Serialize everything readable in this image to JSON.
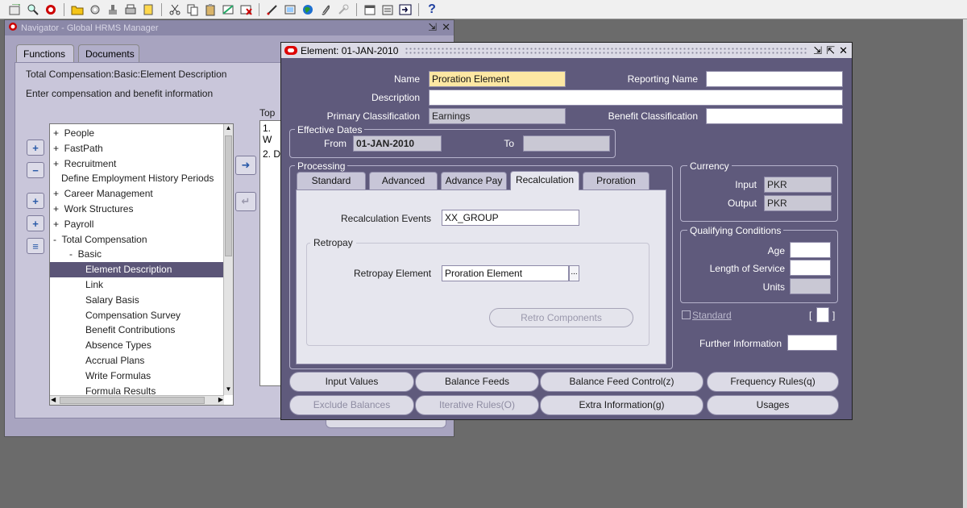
{
  "toolbar": {
    "icons": [
      "new-icon",
      "find-icon",
      "navigator-icon",
      "folder-icon",
      "gear-icon",
      "stamp-icon",
      "print-icon",
      "attachment-icon",
      "cut-icon",
      "copy-icon",
      "paste-icon",
      "clear-record-icon",
      "delete-icon",
      "edit-icon",
      "zoom-icon",
      "globe-icon",
      "paperclip-icon",
      "tools-icon",
      "calendar-icon",
      "folder-tools-icon",
      "window-icon",
      "help-icon"
    ],
    "help_label": "?"
  },
  "navigator": {
    "title": "Navigator - Global HRMS Manager",
    "controls": [
      "⇲",
      "✕"
    ],
    "tabs": [
      {
        "label": "Functions",
        "active": true
      },
      {
        "label": "Documents",
        "active": false
      }
    ],
    "path": "Total Compensation:Basic:Element Description",
    "hint": "Enter compensation and benefit information",
    "top_label": "Top",
    "top_items": [
      "1. W",
      "2. D"
    ],
    "tree": [
      {
        "label": "+  People",
        "indent": 0
      },
      {
        "label": "+  FastPath",
        "indent": 0
      },
      {
        "label": "+  Recruitment",
        "indent": 0
      },
      {
        "label": "   Define Employment History Periods",
        "indent": 0
      },
      {
        "label": "+  Career Management",
        "indent": 0
      },
      {
        "label": "+  Work Structures",
        "indent": 0
      },
      {
        "label": "+  Payroll",
        "indent": 0
      },
      {
        "label": "-  Total Compensation",
        "indent": 0
      },
      {
        "label": "-  Basic",
        "indent": 1
      },
      {
        "label": "Element Description",
        "indent": 2,
        "selected": true
      },
      {
        "label": "Link",
        "indent": 2
      },
      {
        "label": "Salary Basis",
        "indent": 2
      },
      {
        "label": "Compensation Survey",
        "indent": 2
      },
      {
        "label": "Benefit Contributions",
        "indent": 2
      },
      {
        "label": "Absence Types",
        "indent": 2
      },
      {
        "label": "Accrual Plans",
        "indent": 2
      },
      {
        "label": "Write Formulas",
        "indent": 2
      },
      {
        "label": "Formula Results",
        "indent": 2
      }
    ]
  },
  "element": {
    "title": "Element: 01-JAN-2010",
    "controls": [
      "⇲",
      "⇱",
      "✕"
    ],
    "name_label": "Name",
    "name_value": "Proration Element",
    "reporting_name_label": "Reporting Name",
    "reporting_name_value": "",
    "description_label": "Description",
    "description_value": "",
    "primary_class_label": "Primary Classification",
    "primary_class_value": "Earnings",
    "benefit_class_label": "Benefit Classification",
    "benefit_class_value": "",
    "effective_dates": {
      "title": "Effective Dates",
      "from_label": "From",
      "from_value": "01-JAN-2010",
      "to_label": "To",
      "to_value": ""
    },
    "processing": {
      "title": "Processing",
      "tabs": [
        {
          "label": "Standard"
        },
        {
          "label": "Advanced"
        },
        {
          "label": "Advance Pay"
        },
        {
          "label": "Recalculation",
          "active": true
        },
        {
          "label": "Proration"
        }
      ],
      "recalc_events_label": "Recalculation Events",
      "recalc_events_value": "XX_GROUP",
      "retropay_title": "Retropay",
      "retropay_element_label": "Retropay Element",
      "retropay_element_value": "Proration Element",
      "lov_label": "...",
      "retro_components_label": "Retro Components"
    },
    "currency": {
      "title": "Currency",
      "input_label": "Input",
      "input_value": "PKR",
      "output_label": "Output",
      "output_value": "PKR"
    },
    "qualifying": {
      "title": "Qualifying Conditions",
      "age_label": "Age",
      "age_value": "",
      "los_label": "Length of Service",
      "los_value": "",
      "units_label": "Units",
      "units_value": ""
    },
    "standard_label": "Standard",
    "standard_checked": false,
    "dff_open": "[",
    "dff_close": "]",
    "further_info_label": "Further Information",
    "further_info_value": "",
    "buttons_row1": [
      {
        "label": "Input Values",
        "enabled": true
      },
      {
        "label": "Balance Feeds",
        "enabled": true
      },
      {
        "label": "Balance Feed Control(z)",
        "enabled": true
      },
      {
        "label": "Frequency Rules(q)",
        "enabled": true
      }
    ],
    "buttons_row2": [
      {
        "label": "Exclude Balances",
        "enabled": false
      },
      {
        "label": "Iterative Rules(O)",
        "enabled": false
      },
      {
        "label": "Extra Information(g)",
        "enabled": true
      },
      {
        "label": "Usages",
        "enabled": true
      }
    ]
  }
}
